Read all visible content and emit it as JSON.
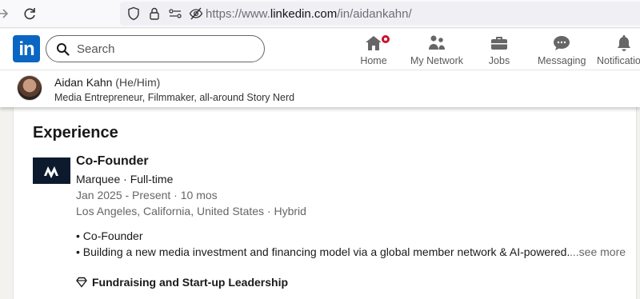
{
  "browser": {
    "url_prefix": "https://www.",
    "url_domain": "linkedin.com",
    "url_path": "/in/aidankahn/"
  },
  "header": {
    "logo_text": "in",
    "search_placeholder": "Search",
    "nav": [
      {
        "label": "Home",
        "icon": "home-icon"
      },
      {
        "label": "My Network",
        "icon": "network-icon"
      },
      {
        "label": "Jobs",
        "icon": "briefcase-icon"
      },
      {
        "label": "Messaging",
        "icon": "messaging-icon"
      },
      {
        "label": "Notifications",
        "icon": "bell-icon"
      }
    ]
  },
  "profile": {
    "name": "Aidan Kahn",
    "pronouns": "(He/Him)",
    "headline": "Media Entrepreneur, Filmmaker, all-around Story Nerd"
  },
  "experience": {
    "section_title": "Experience",
    "title": "Co-Founder",
    "company": "Marquee · Full-time",
    "dates": "Jan 2025 - Present · 10 mos",
    "location": "Los Angeles, California, United States · Hybrid",
    "bullets": [
      "• Co-Founder",
      "• Building a new media investment and financing model via a global member network & AI-powered."
    ],
    "see_more": "...see more",
    "skill": "Fundraising and Start-up Leadership"
  },
  "colors": {
    "brand": "#0a66c2",
    "badge": "#cb112d"
  }
}
